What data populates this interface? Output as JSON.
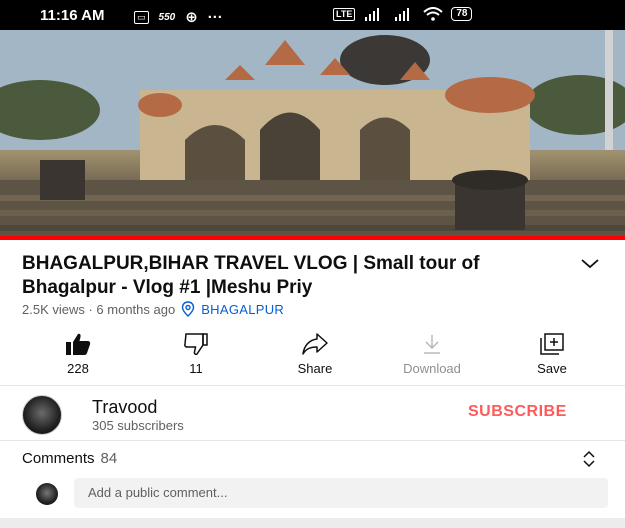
{
  "status_bar": {
    "time": "11:16 AM",
    "speed": "550",
    "sim_badge": "LTE",
    "battery": "78"
  },
  "video": {
    "progress": 1.0
  },
  "title": "BHAGALPUR,BIHAR TRAVEL VLOG | Small tour of Bhagalpur - Vlog #1 |Meshu Priy",
  "meta": {
    "views": "2.5K views · 6 months ago",
    "location": "BHAGALPUR"
  },
  "actions": {
    "like": "228",
    "dislike": "11",
    "share": "Share",
    "download": "Download",
    "save": "Save"
  },
  "channel": {
    "name": "Travood",
    "subscribers": "305 subscribers",
    "subscribe_label": "SUBSCRIBE"
  },
  "comments": {
    "label": "Comments",
    "count": "84",
    "placeholder": "Add a public comment..."
  },
  "colors": {
    "accent_red": "#ff0000",
    "subscribe": "#ff5a5a",
    "link_blue": "#065fd4"
  }
}
